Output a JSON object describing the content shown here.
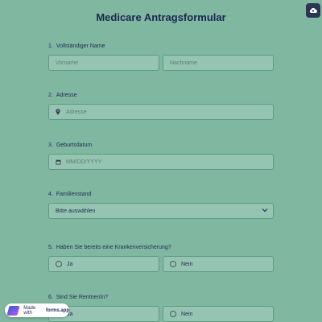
{
  "header": {
    "title": "Medicare Antragsformular"
  },
  "questions": [
    {
      "num": "1.",
      "label": "Vollständiger Name",
      "first_placeholder": "Vorname",
      "last_placeholder": "Nachname"
    },
    {
      "num": "2.",
      "label": "Adresse",
      "placeholder": "Adresse"
    },
    {
      "num": "3.",
      "label": "Geburtsdatum",
      "placeholder": "MM/DD/YYYY"
    },
    {
      "num": "4.",
      "label": "Familienstand",
      "selected": "Bitte auswählen"
    },
    {
      "num": "5.",
      "label": "Haben Sie bereits eine Krankenversicherung?",
      "options": [
        "Ja",
        "Nein"
      ]
    },
    {
      "num": "6.",
      "label": "Sind Sie Rentner/in?",
      "options": [
        "Ja",
        "Nein"
      ]
    }
  ],
  "badge": {
    "prefix": "Made with",
    "brand": "forms.app"
  },
  "colors": {
    "background": "#80b7a1",
    "field": "#95c4b2",
    "text": "#1e2a52"
  },
  "icons": [
    "cloud-upload-icon",
    "location-pin-icon",
    "calendar-icon",
    "chevron-down-icon",
    "radio-icon",
    "forms-app-logo-icon"
  ]
}
